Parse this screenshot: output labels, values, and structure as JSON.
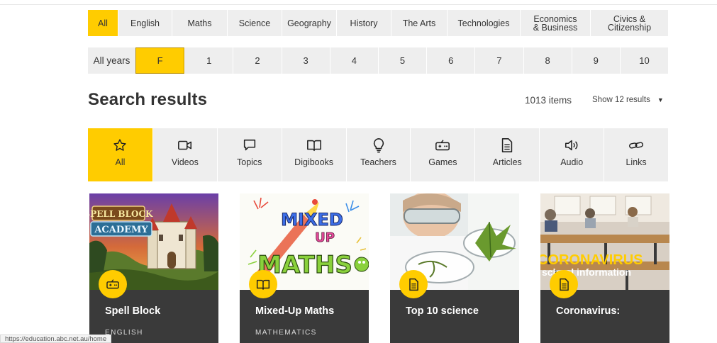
{
  "subjects": [
    {
      "label": "All",
      "active": true
    },
    {
      "label": "English"
    },
    {
      "label": "Maths"
    },
    {
      "label": "Science"
    },
    {
      "label": "Geography"
    },
    {
      "label": "History"
    },
    {
      "label": "The Arts"
    },
    {
      "label": "Technologies"
    },
    {
      "label": "Economics\n& Business"
    },
    {
      "label": "Civics &\nCitizenship"
    }
  ],
  "years": {
    "label": "All years",
    "items": [
      "F",
      "1",
      "2",
      "3",
      "4",
      "5",
      "6",
      "7",
      "8",
      "9",
      "10"
    ],
    "active": "F"
  },
  "results": {
    "title": "Search results",
    "count": "1013 items",
    "show": "Show 12 results"
  },
  "types": [
    {
      "label": "All",
      "icon": "star-icon",
      "active": true
    },
    {
      "label": "Videos",
      "icon": "video-camera-icon"
    },
    {
      "label": "Topics",
      "icon": "speech-bubble-icon"
    },
    {
      "label": "Digibooks",
      "icon": "open-book-icon"
    },
    {
      "label": "Teachers",
      "icon": "lightbulb-icon"
    },
    {
      "label": "Games",
      "icon": "game-controller-icon"
    },
    {
      "label": "Articles",
      "icon": "document-icon"
    },
    {
      "label": "Audio",
      "icon": "speaker-icon"
    },
    {
      "label": "Links",
      "icon": "link-icon"
    }
  ],
  "cards": [
    {
      "title": "Spell Block",
      "subtitle": "ENGLISH",
      "badge_icon": "game-controller-icon",
      "thumb_text_1": "SPELL BLOCK",
      "thumb_text_2": "ACADEMY"
    },
    {
      "title": "Mixed-Up Maths",
      "subtitle": "MATHEMATICS",
      "badge_icon": "open-book-icon",
      "thumb_text_1": "MIXED",
      "thumb_text_2": "UP",
      "thumb_text_3": "MATHS"
    },
    {
      "title": "Top 10 science",
      "subtitle": "",
      "badge_icon": "document-icon"
    },
    {
      "title": "Coronavirus:",
      "subtitle": "",
      "badge_icon": "document-icon",
      "thumb_text_1": "CORONAVIRUS",
      "thumb_text_2": "school information"
    }
  ],
  "status_url": "https://education.abc.net.au/home",
  "colors": {
    "accent": "#ffcc00",
    "card_bg": "#3a3a3a",
    "filter_bg": "#eeeeee"
  }
}
